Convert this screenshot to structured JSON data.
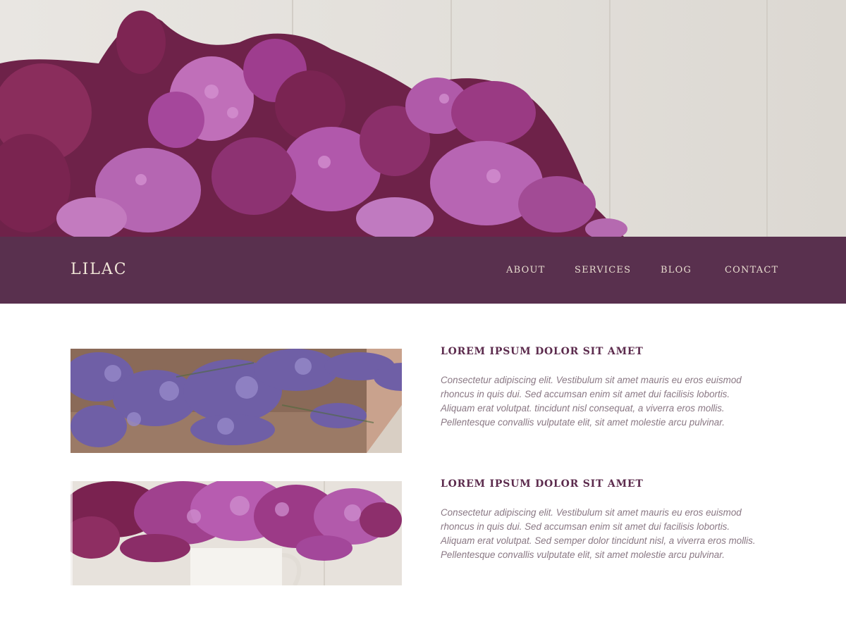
{
  "header": {
    "brand": "LILAC",
    "nav": [
      {
        "label": "ABOUT"
      },
      {
        "label": "SERVICES"
      },
      {
        "label": "BLOG"
      },
      {
        "label": "CONTACT"
      }
    ]
  },
  "features": [
    {
      "title": "LOREM IPSUM DOLOR SIT AMET",
      "lines": [
        "Consectetur adipiscing elit. Vestibulum sit amet mauris eu eros euismod",
        "rhoncus in quis dui. Sed accumsan enim sit amet dui facilisis lobortis.",
        "Aliquam erat volutpat. tincidunt nisl consequat, a viverra eros mollis.",
        "Pellentesque convallis vulputate elit, sit amet molestie arcu pulvinar."
      ]
    },
    {
      "title": "LOREM IPSUM DOLOR SIT AMET",
      "lines": [
        "Consectetur adipiscing elit. Vestibulum sit amet mauris eu eros euismod",
        "rhoncus in quis dui. Sed accumsan enim sit amet dui facilisis lobortis.",
        "Aliquam erat volutpat. Sed semper dolor tincidunt nisl, a viverra eros mollis.",
        "Pellentesque convallis vulputate elit, sit amet molestie arcu pulvinar."
      ]
    }
  ],
  "colors": {
    "brand_purple": "#59304e",
    "title_purple": "#5c2b4d",
    "nav_text": "#e8dccf",
    "body_text": "#8a7884"
  }
}
